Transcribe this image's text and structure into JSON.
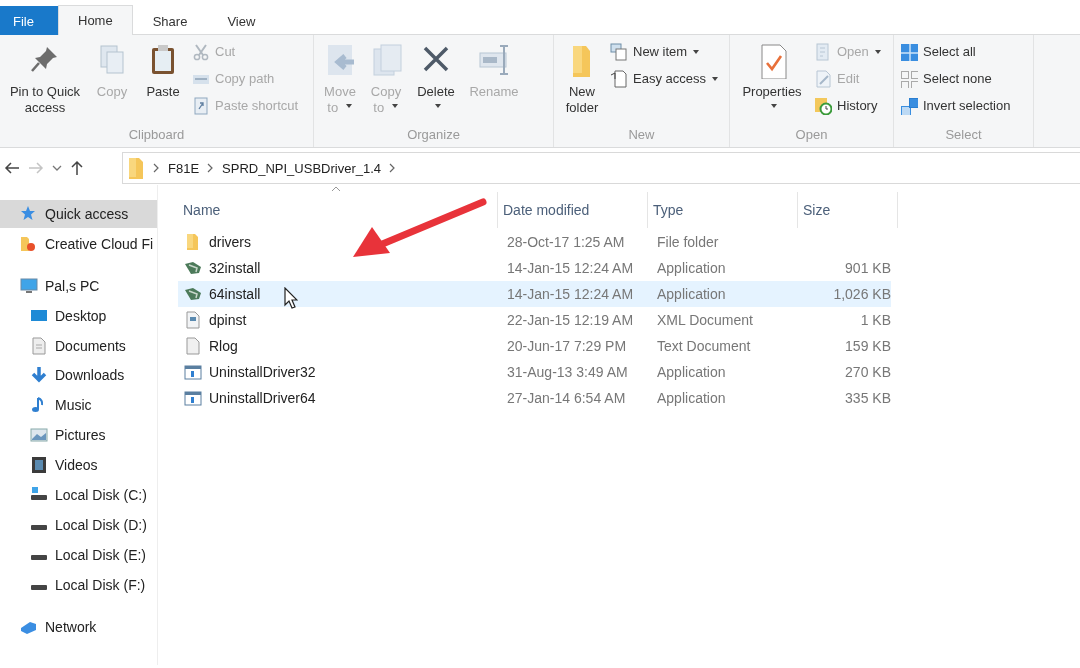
{
  "tabs": [
    {
      "label": "File",
      "kind": "file",
      "selected": false
    },
    {
      "label": "Home",
      "kind": "tab",
      "selected": true
    },
    {
      "label": "Share",
      "kind": "tab",
      "selected": false
    },
    {
      "label": "View",
      "kind": "tab",
      "selected": false
    }
  ],
  "ribbon": {
    "groups": [
      {
        "label": "Clipboard",
        "items": [
          {
            "label": "Pin to Quick access",
            "kind": "large",
            "disabled": false,
            "dropdown": false
          },
          {
            "label": "Copy",
            "kind": "large",
            "disabled": true,
            "dropdown": false
          },
          {
            "label": "Paste",
            "kind": "large",
            "disabled": false,
            "dropdown": false
          },
          {
            "label": "Cut",
            "kind": "small",
            "disabled": true,
            "dropdown": false
          },
          {
            "label": "Copy path",
            "kind": "small",
            "disabled": true,
            "dropdown": false
          },
          {
            "label": "Paste shortcut",
            "kind": "small",
            "disabled": true,
            "dropdown": false
          }
        ]
      },
      {
        "label": "Organize",
        "items": [
          {
            "label": "Move to",
            "kind": "large",
            "disabled": true,
            "dropdown": true
          },
          {
            "label": "Copy to",
            "kind": "large",
            "disabled": true,
            "dropdown": true
          },
          {
            "label": "Delete",
            "kind": "large",
            "disabled": false,
            "dropdown": true
          },
          {
            "label": "Rename",
            "kind": "large",
            "disabled": true,
            "dropdown": false
          }
        ]
      },
      {
        "label": "New",
        "items": [
          {
            "label": "New folder",
            "kind": "large",
            "disabled": false,
            "dropdown": false
          },
          {
            "label": "New item",
            "kind": "small",
            "disabled": false,
            "dropdown": true
          },
          {
            "label": "Easy access",
            "kind": "small",
            "disabled": false,
            "dropdown": true
          }
        ]
      },
      {
        "label": "Open",
        "items": [
          {
            "label": "Properties",
            "kind": "large",
            "disabled": false,
            "dropdown": true
          },
          {
            "label": "Open",
            "kind": "small",
            "disabled": true,
            "dropdown": true
          },
          {
            "label": "Edit",
            "kind": "small",
            "disabled": true,
            "dropdown": false
          },
          {
            "label": "History",
            "kind": "small",
            "disabled": false,
            "dropdown": false
          }
        ]
      },
      {
        "label": "Select",
        "items": [
          {
            "label": "Select all",
            "kind": "small",
            "disabled": false,
            "dropdown": false
          },
          {
            "label": "Select none",
            "kind": "small",
            "disabled": false,
            "dropdown": false
          },
          {
            "label": "Invert selection",
            "kind": "small",
            "disabled": false,
            "dropdown": false
          }
        ]
      }
    ]
  },
  "address": {
    "segments": [
      "F81E",
      "SPRD_NPI_USBDriver_1.4"
    ]
  },
  "sidebar": {
    "items": [
      {
        "label": "Quick access",
        "kind": "star",
        "selected": true
      },
      {
        "label": "Creative Cloud Fi",
        "kind": "cloud",
        "selected": false
      },
      {
        "label": "Pal,s  PC",
        "kind": "pc",
        "selected": false,
        "children": [
          {
            "label": "Desktop",
            "kind": "desktop",
            "selected": false
          },
          {
            "label": "Documents",
            "kind": "documents",
            "selected": false
          },
          {
            "label": "Downloads",
            "kind": "downloads",
            "selected": false
          },
          {
            "label": "Music",
            "kind": "music",
            "selected": false
          },
          {
            "label": "Pictures",
            "kind": "pictures",
            "selected": false
          },
          {
            "label": "Videos",
            "kind": "videos",
            "selected": false
          },
          {
            "label": "Local Disk (C:)",
            "kind": "system-disk",
            "selected": false
          },
          {
            "label": "Local Disk (D:)",
            "kind": "disk",
            "selected": false
          },
          {
            "label": "Local Disk (E:)",
            "kind": "disk",
            "selected": false
          },
          {
            "label": "Local Disk (F:)",
            "kind": "disk",
            "selected": false
          }
        ]
      },
      {
        "label": "Network",
        "kind": "network",
        "selected": false
      }
    ]
  },
  "table": {
    "columns": [
      "Name",
      "Date modified",
      "Type",
      "Size"
    ],
    "rows": [
      {
        "name": "drivers",
        "date": "28-Oct-17 1:25 AM",
        "type": "File folder",
        "size": "",
        "kind": "folder",
        "hovered": false
      },
      {
        "name": "32install",
        "date": "14-Jan-15 12:24 AM",
        "type": "Application",
        "size": "901 KB",
        "kind": "installer",
        "hovered": false
      },
      {
        "name": "64install",
        "date": "14-Jan-15 12:24 AM",
        "type": "Application",
        "size": "1,026 KB",
        "kind": "installer",
        "hovered": true
      },
      {
        "name": "dpinst",
        "date": "22-Jan-15 12:19 AM",
        "type": "XML Document",
        "size": "1 KB",
        "kind": "xml",
        "hovered": false
      },
      {
        "name": "Rlog",
        "date": "20-Jun-17 7:29 PM",
        "type": "Text Document",
        "size": "159 KB",
        "kind": "text",
        "hovered": false
      },
      {
        "name": "UninstallDriver32",
        "date": "31-Aug-13 3:49 AM",
        "type": "Application",
        "size": "270 KB",
        "kind": "app",
        "hovered": false
      },
      {
        "name": "UninstallDriver64",
        "date": "27-Jan-14 6:54 AM",
        "type": "Application",
        "size": "335 KB",
        "kind": "app",
        "hovered": false
      }
    ]
  }
}
